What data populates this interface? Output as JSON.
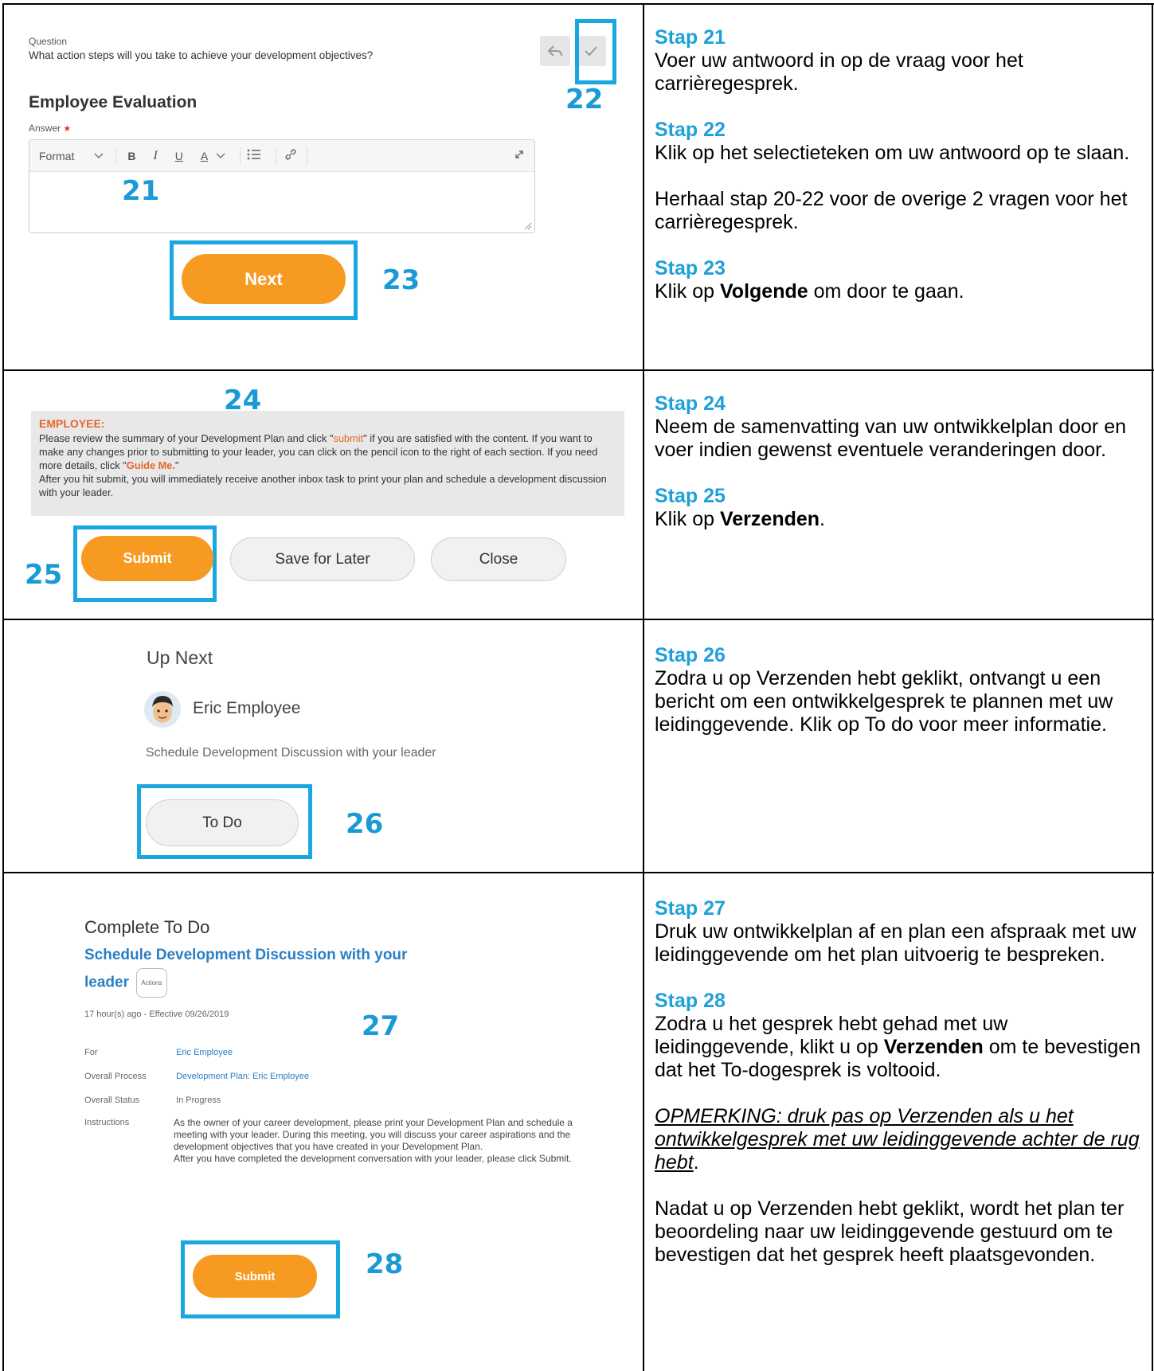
{
  "row1": {
    "screenshot": {
      "question_label": "Question",
      "question_text": "What action steps will you take to achieve your development objectives?",
      "section_title": "Employee Evaluation",
      "answer_label": "Answer",
      "required_mark": "★",
      "toolbar": {
        "format": "Format",
        "bold": "B",
        "italic": "I",
        "underline": "U",
        "font_color": "A"
      },
      "next_label": "Next",
      "callout_21": "21",
      "callout_22": "22",
      "callout_23": "23"
    },
    "steps": [
      {
        "title": "Stap 21",
        "text": "Voer uw antwoord in op de vraag voor het carrièregesprek."
      },
      {
        "title": "Stap 22",
        "text": "Klik op het selectieteken om uw antwoord op te slaan."
      },
      {
        "title": "",
        "text": "Herhaal stap 20-22 voor de overige 2 vragen voor het carrièregesprek."
      },
      {
        "title": "Stap 23",
        "text_before": "Klik op ",
        "bold": "Volgende",
        "text_after": " om door te gaan."
      }
    ]
  },
  "row2": {
    "screenshot": {
      "header": "EMPLOYEE:",
      "body_1a": "Please review the summary of your Development Plan and click \"",
      "submit_word": "submit",
      "body_1b": "\" if you are satisfied with the content. If you want to make any changes prior to submitting to your leader, you can click on the pencil icon to the right of each section. If you need more details, click \"",
      "guide_word": "Guide Me.",
      "body_1c": "\"",
      "body_2": "After you hit submit, you will immediately receive another inbox task to print your plan and schedule a development discussion with your leader.",
      "submit_label": "Submit",
      "save_later_label": "Save for Later",
      "close_label": "Close",
      "callout_24": "24",
      "callout_25": "25"
    },
    "steps": [
      {
        "title": "Stap 24",
        "text": "Neem de samenvatting van uw ontwikkelplan door en voer indien gewenst eventuele veranderingen door."
      },
      {
        "title": "Stap 25",
        "text_before": "Klik op ",
        "bold": "Verzenden",
        "text_after": "."
      }
    ]
  },
  "row3": {
    "screenshot": {
      "title": "Up Next",
      "person": "Eric Employee",
      "task": "Schedule Development Discussion with your leader",
      "todo_label": "To Do",
      "callout_26": "26"
    },
    "steps": [
      {
        "title": "Stap 26",
        "text": "Zodra u op Verzenden hebt geklikt, ontvangt u een bericht om een ontwikkelgesprek te plannen met uw leidinggevende. Klik op To do voor meer informatie."
      }
    ]
  },
  "row4": {
    "screenshot": {
      "title": "Complete To Do",
      "link_line1": "Schedule Development Discussion with your",
      "link_line2": "leader",
      "actions_badge": "Actions",
      "meta": "17 hour(s) ago - Effective 09/26/2019",
      "fields": [
        {
          "label": "For",
          "value": "Eric Employee",
          "link": true
        },
        {
          "label": "Overall Process",
          "value": "Development Plan: Eric Employee",
          "link": true
        },
        {
          "label": "Overall Status",
          "value": "In Progress",
          "link": false
        }
      ],
      "instructions_label": "Instructions",
      "instructions_1": "As the owner of your career development, please print your Development Plan and schedule a meeting with your leader. During this meeting, you will discuss your career aspirations and the development objectives that you have created in your Development Plan.",
      "instructions_2": "After you have completed the development conversation with your leader, please click Submit.",
      "submit_label": "Submit",
      "callout_27": "27",
      "callout_28": "28"
    },
    "steps": [
      {
        "title": "Stap 27",
        "text": "Druk uw ontwikkelplan af en plan een afspraak met uw leidinggevende om het plan uitvoerig te bespreken."
      },
      {
        "title": "Stap 28",
        "text_before": "Zodra u het gesprek hebt gehad met uw leidinggevende, klikt u op ",
        "bold": "Verzenden",
        "text_after": " om te bevestigen dat het To-dogesprek is voltooid."
      },
      {
        "note": "OPMERKING: druk pas op Verzenden als u het ontwikkelgesprek met uw leidinggevende achter de rug hebt",
        "note_after": "."
      },
      {
        "text": "Nadat u op Verzenden hebt geklikt, wordt het plan ter beoordeling naar uw leidinggevende gestuurd om te bevestigen dat het gesprek heeft plaatsgevonden."
      }
    ]
  }
}
